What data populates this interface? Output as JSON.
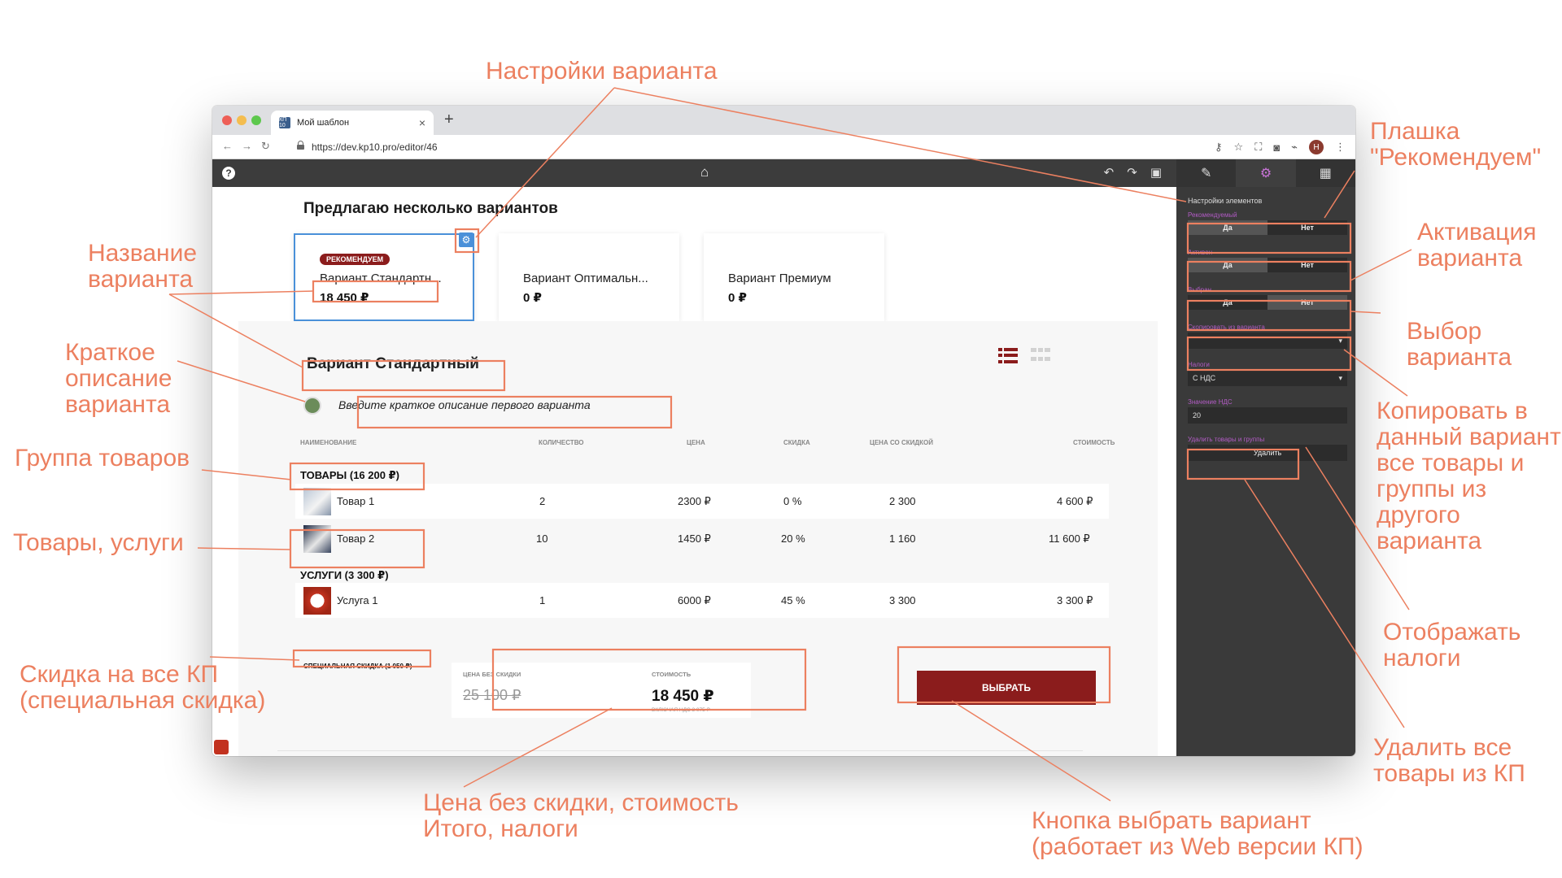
{
  "browser": {
    "tab_title": "Мой шаблон",
    "tab_favicon": "КП 10",
    "tab_close": "×",
    "new_tab": "+",
    "url": "https://dev.kp10.pro/editor/46"
  },
  "appbar": {
    "help": "?",
    "icons": [
      "home-icon",
      "undo-icon",
      "redo-icon",
      "save-icon"
    ]
  },
  "right_panel": {
    "tabs": [
      "wrench-icon",
      "gear-icon",
      "grid-icon"
    ],
    "title": "Настройки элементов",
    "recommended": {
      "label": "Рекомендуемый",
      "yes": "Да",
      "no": "Нет",
      "value": "Да"
    },
    "active": {
      "label": "Активен",
      "yes": "Да",
      "no": "Нет",
      "value": "Да"
    },
    "selected": {
      "label": "Выбран",
      "yes": "Да",
      "no": "Нет",
      "value": "Нет"
    },
    "copy_from": {
      "label": "Скопировать из варианта",
      "value": ""
    },
    "taxes": {
      "label": "Налоги",
      "value": "С НДС"
    },
    "vat_value": {
      "label": "Значение НДС",
      "value": "20"
    },
    "delete_items": {
      "label": "Удалить товары и группы",
      "button": "Удалить"
    }
  },
  "page": {
    "title": "Предлагаю несколько вариантов",
    "variants": [
      {
        "badge": "РЕКОМЕНДУЕМ",
        "name": "Вариант Стандартн...",
        "price": "18 450 ₽"
      },
      {
        "badge": "",
        "name": "Вариант Оптимальн...",
        "price": "0 ₽"
      },
      {
        "badge": "",
        "name": "Вариант Премиум",
        "price": "0 ₽"
      }
    ],
    "variant_title": "Вариант Стандартный",
    "description": "Введите краткое описание первого варианта",
    "table": {
      "headers": [
        "НАИМЕНОВАНИЕ",
        "КОЛИЧЕСТВО",
        "ЦЕНА",
        "СКИДКА",
        "ЦЕНА СО СКИДКОЙ",
        "СТОИМОСТЬ"
      ],
      "groups": [
        {
          "title": "ТОВАРЫ (16 200 ₽)",
          "items": [
            {
              "name": "Товар 1",
              "qty": "2",
              "price": "2300 ₽",
              "discount": "0 %",
              "disc_price": "2 300",
              "total": "4 600 ₽"
            },
            {
              "name": "Товар 2",
              "qty": "10",
              "price": "1450 ₽",
              "discount": "20 %",
              "disc_price": "1 160",
              "total": "11 600 ₽"
            }
          ]
        },
        {
          "title": "УСЛУГИ (3 300 ₽)",
          "items": [
            {
              "name": "Услуга 1",
              "qty": "1",
              "price": "6000 ₽",
              "discount": "45 %",
              "disc_price": "3 300",
              "total": "3 300 ₽"
            }
          ]
        }
      ]
    },
    "special_discount": "СПЕЦИАЛЬНАЯ СКИДКА (1 050 ₽)",
    "totals": {
      "no_discount_label": "ЦЕНА БЕЗ СКИДКИ",
      "no_discount_value": "25 100 ₽",
      "total_label": "СТОИМОСТЬ",
      "total_value": "18 450 ₽",
      "vat_note": "ВКЛЮЧАЯ НДС 3 075 ₽"
    },
    "choose_button": "ВЫБРАТЬ"
  },
  "annotations": {
    "variant_settings": "Настройки варианта",
    "variant_name": "Название\nварианта",
    "short_desc": "Краткое\nописание\nварианта",
    "product_group": "Группа товаров",
    "products_services": "Товары, услуги",
    "discount_all": "Скидка на все КП\n(специальная скидка)",
    "price_totals": "Цена без скидки, стоимость\nИтого, налоги",
    "choose_btn": "Кнопка выбрать вариант\n(работает из Web версии КП)",
    "recommend_badge": "Плашка\n\"Рекомендуем\"",
    "activation": "Активация\nварианта",
    "selection": "Выбор\nварианта",
    "copy": "Копировать в\nданный вариант\nвсе товары и\nгруппы из\nдругого\nварианта",
    "show_taxes": "Отображать\nналоги",
    "delete_all": "Удалить все\nтовары из КП"
  },
  "colors": {
    "accent": "#8b1c1c",
    "annotation": "#ec8060",
    "selection": "#4a90d9",
    "panel": "#3a3a3a"
  }
}
